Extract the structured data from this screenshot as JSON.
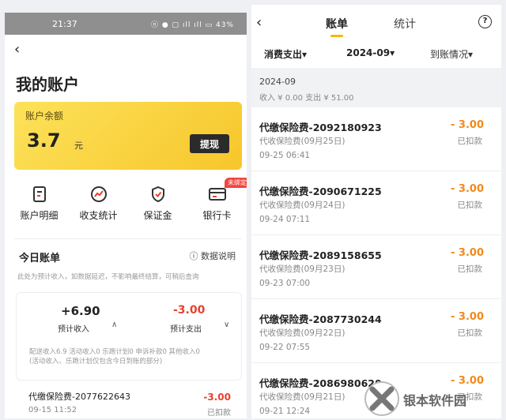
{
  "left": {
    "status": {
      "time": "21:37",
      "icons": "ⓝ ● ▢ ıll ıll ▭ 43%"
    },
    "title": "我的账户",
    "balance": {
      "label": "账户余额",
      "amount": "3.7",
      "unit": "元",
      "withdraw": "提现"
    },
    "quick": {
      "detail": "账户明细",
      "stats": "收支统计",
      "deposit": "保证金",
      "card": "银行卡",
      "card_badge": "未绑定"
    },
    "today": {
      "title": "今日账单",
      "explain": "ⓘ 数据说明"
    },
    "note": "此处为预计收入，如数据延迟，不影响最终结算，可稍后查询",
    "summary": {
      "income": "+6.90",
      "income_label": "预计收入",
      "expense": "-3.00",
      "expense_label": "预计支出",
      "detail1": "配送收入6.9 活动收入0 乐跑计划0 申诉补款0 其他收入0",
      "detail2": "(活动收入、乐跑计划仅包含今日到账的部分)"
    },
    "entry": {
      "title": "代缴保险费-2077622643",
      "date": "09-15 11:52",
      "amount": "-3.00",
      "status": "已扣款"
    }
  },
  "right": {
    "tabs": {
      "bill": "账单",
      "stats": "统计"
    },
    "help": "?",
    "filters": {
      "type": "消费支出▾",
      "month": "2024-09▾",
      "arrival": "到账情况▾"
    },
    "month": {
      "label": "2024-09",
      "summary": "收入 ¥ 0.00  支出 ¥ 51.00"
    },
    "entries": [
      {
        "title": "代缴保险费-2092180923",
        "cat": "代收保险费(09月25日)",
        "date": "09-25 06:41",
        "amount": "- 3.00",
        "status": "已扣款"
      },
      {
        "title": "代缴保险费-2090671225",
        "cat": "代收保险费(09月24日)",
        "date": "09-24 07:11",
        "amount": "- 3.00",
        "status": "已扣款"
      },
      {
        "title": "代缴保险费-2089158655",
        "cat": "代收保险费(09月23日)",
        "date": "09-23 07:00",
        "amount": "- 3.00",
        "status": "已扣款"
      },
      {
        "title": "代缴保险费-2087730244",
        "cat": "代收保险费(09月22日)",
        "date": "09-22 07:55",
        "amount": "- 3.00",
        "status": "已扣款"
      },
      {
        "title": "代缴保险费-2086980620",
        "cat": "代收保险费(09月21日)",
        "date": "09-21 12:24",
        "amount": "- 3.00",
        "status": "已扣款"
      }
    ]
  },
  "watermark": "银本软件园",
  "colors": {
    "accent": "#f7c62b",
    "expense": "#e8402e",
    "amount_orange": "#f08a1c",
    "badge": "#f2453d"
  }
}
